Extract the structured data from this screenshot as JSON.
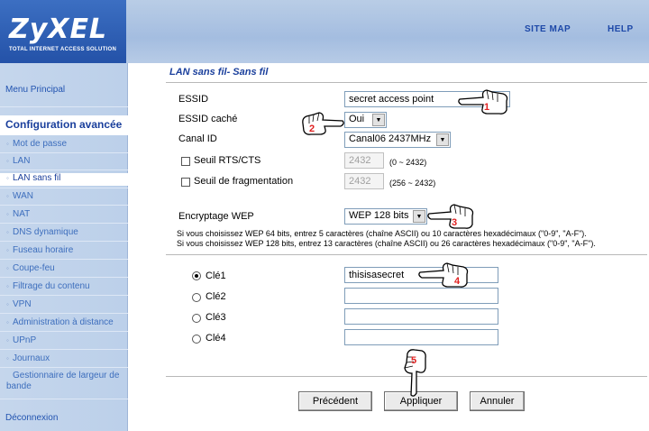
{
  "header": {
    "brand": "ZyXEL",
    "tagline": "TOTAL INTERNET ACCESS SOLUTION",
    "site_map": "SITE MAP",
    "help": "HELP"
  },
  "sidebar": {
    "main_menu": "Menu Principal",
    "section": "Configuration avancée",
    "items": [
      {
        "label": "Mot de passe"
      },
      {
        "label": "LAN"
      },
      {
        "label": "LAN sans fil"
      },
      {
        "label": "WAN"
      },
      {
        "label": "NAT"
      },
      {
        "label": "DNS dynamique"
      },
      {
        "label": "Fuseau horaire"
      },
      {
        "label": "Coupe-feu"
      },
      {
        "label": "Filtrage du contenu"
      },
      {
        "label": "VPN"
      },
      {
        "label": "Administration à distance"
      },
      {
        "label": "UPnP"
      },
      {
        "label": "Journaux"
      },
      {
        "label": "Gestionnaire de largeur de bande"
      }
    ],
    "logout": "Déconnexion"
  },
  "main": {
    "title": "LAN sans fil- Sans fil",
    "essid_label": "ESSID",
    "essid_value": "secret access point",
    "hidden_label": "ESSID caché",
    "hidden_value": "Oui",
    "channel_label": "Canal ID",
    "channel_value": "Canal06 2437MHz",
    "rts_label": "Seuil RTS/CTS",
    "rts_value": "2432",
    "rts_range": "(0 ~ 2432)",
    "frag_label": "Seuil de fragmentation",
    "frag_value": "2432",
    "frag_range": "(256 ~ 2432)",
    "wep_label": "Encryptage WEP",
    "wep_value": "WEP 128 bits",
    "info1": "Si vous choisissez WEP 64 bits, entrez 5 caractères (chaîne ASCII) ou 10 caractères hexadécimaux (\"0-9\", \"A-F\").",
    "info2": "Si vous choisissez WEP 128 bits, entrez 13 caractères (chaîne ASCII) ou 26 caractères hexadécimaux (\"0-9\", \"A-F\").",
    "keys": [
      {
        "label": "Clé1",
        "value": "thisisasecret"
      },
      {
        "label": "Clé2",
        "value": ""
      },
      {
        "label": "Clé3",
        "value": ""
      },
      {
        "label": "Clé4",
        "value": ""
      }
    ],
    "buttons": {
      "previous": "Précédent",
      "apply": "Appliquer",
      "cancel": "Annuler"
    }
  },
  "annotations": [
    "1",
    "2",
    "3",
    "4",
    "5"
  ],
  "colors": {
    "brand_blue": "#2452a8",
    "link_blue": "#1d48a8",
    "annotation_red": "#e02020"
  }
}
